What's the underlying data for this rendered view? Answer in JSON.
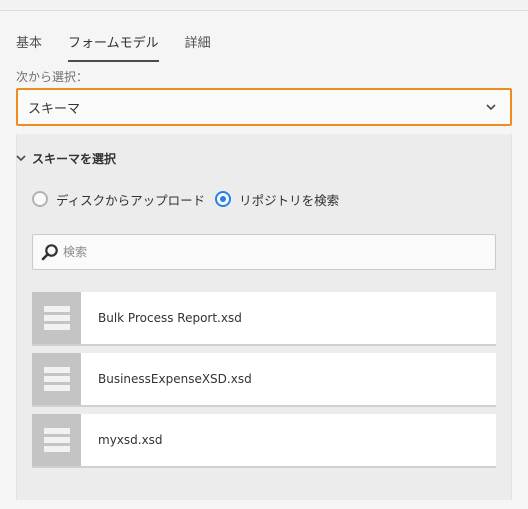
{
  "tabs": [
    {
      "label": "基本"
    },
    {
      "label": "フォームモデル"
    },
    {
      "label": "詳細"
    }
  ],
  "select": {
    "label": "次から選択：",
    "value": "スキーマ"
  },
  "panel": {
    "title": "スキーマを選択",
    "radios": [
      {
        "label": "ディスクからアップロード",
        "checked": false
      },
      {
        "label": "リポジトリを検索",
        "checked": true
      }
    ],
    "search": {
      "placeholder": "検索",
      "value": ""
    },
    "files": [
      {
        "name": "Bulk Process Report.xsd",
        "icon": "schema-file-icon"
      },
      {
        "name": "BusinessExpenseXSD.xsd",
        "icon": "schema-file-icon"
      },
      {
        "name": "myxsd.xsd",
        "icon": "schema-file-icon"
      }
    ]
  },
  "colors": {
    "accent_border": "#f08c1e",
    "radio_selected": "#2680eb"
  }
}
